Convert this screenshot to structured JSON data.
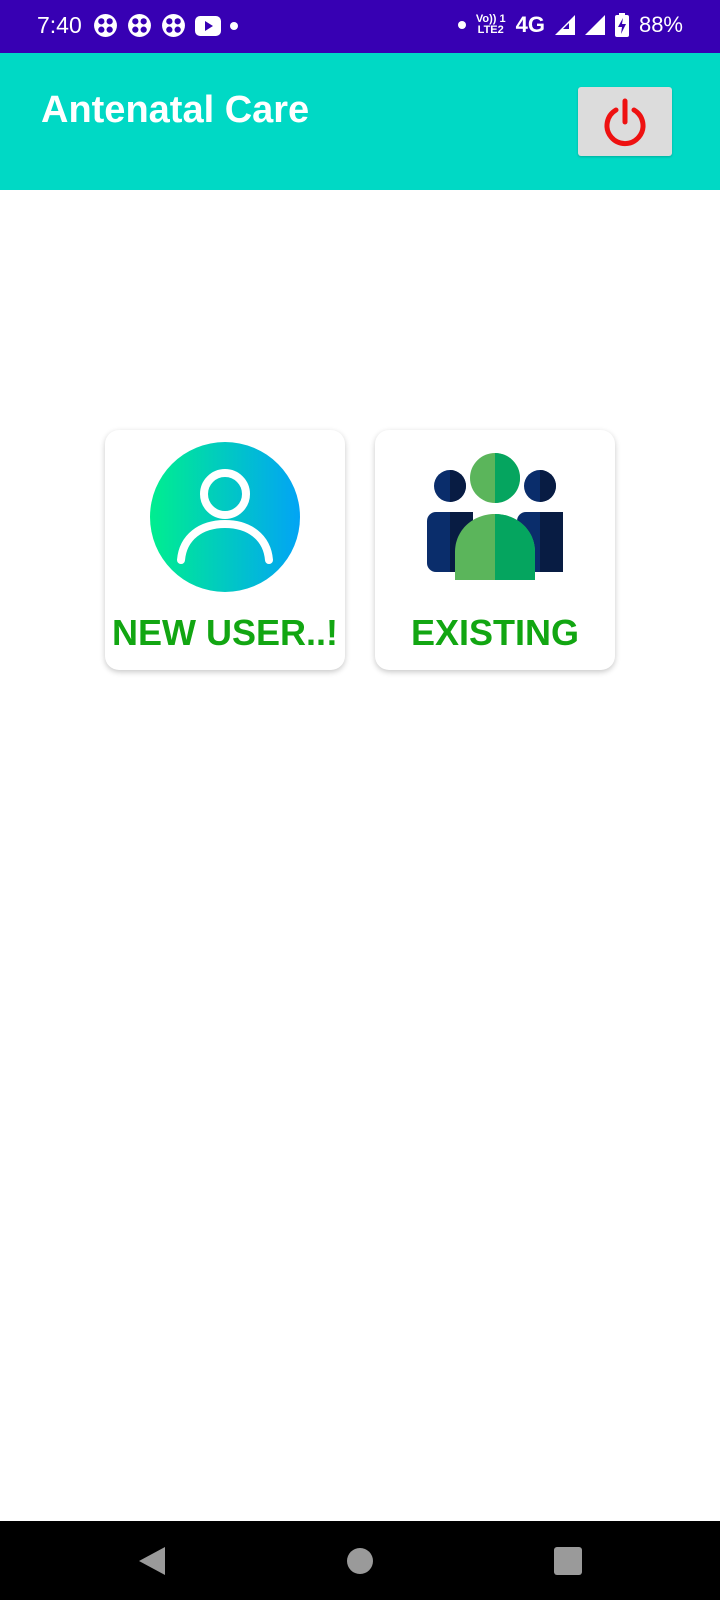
{
  "status_bar": {
    "time": "7:40",
    "network": "4G",
    "volte_top": "Vo)) 1",
    "volte_bottom": "LTE2",
    "battery": "88%",
    "background": "#3700b3"
  },
  "app_bar": {
    "title": "Antenatal Care",
    "background": "#00d9c5",
    "power_icon": "power-icon",
    "power_color": "#ee1111"
  },
  "cards": [
    {
      "label": "NEW USER..!",
      "icon": "new-user-icon"
    },
    {
      "label": "EXISTING",
      "icon": "existing-users-icon"
    }
  ],
  "label_color": "#12a612",
  "nav_bar": {
    "back_icon": "back-icon",
    "home_icon": "home-icon",
    "recents_icon": "recents-icon"
  }
}
